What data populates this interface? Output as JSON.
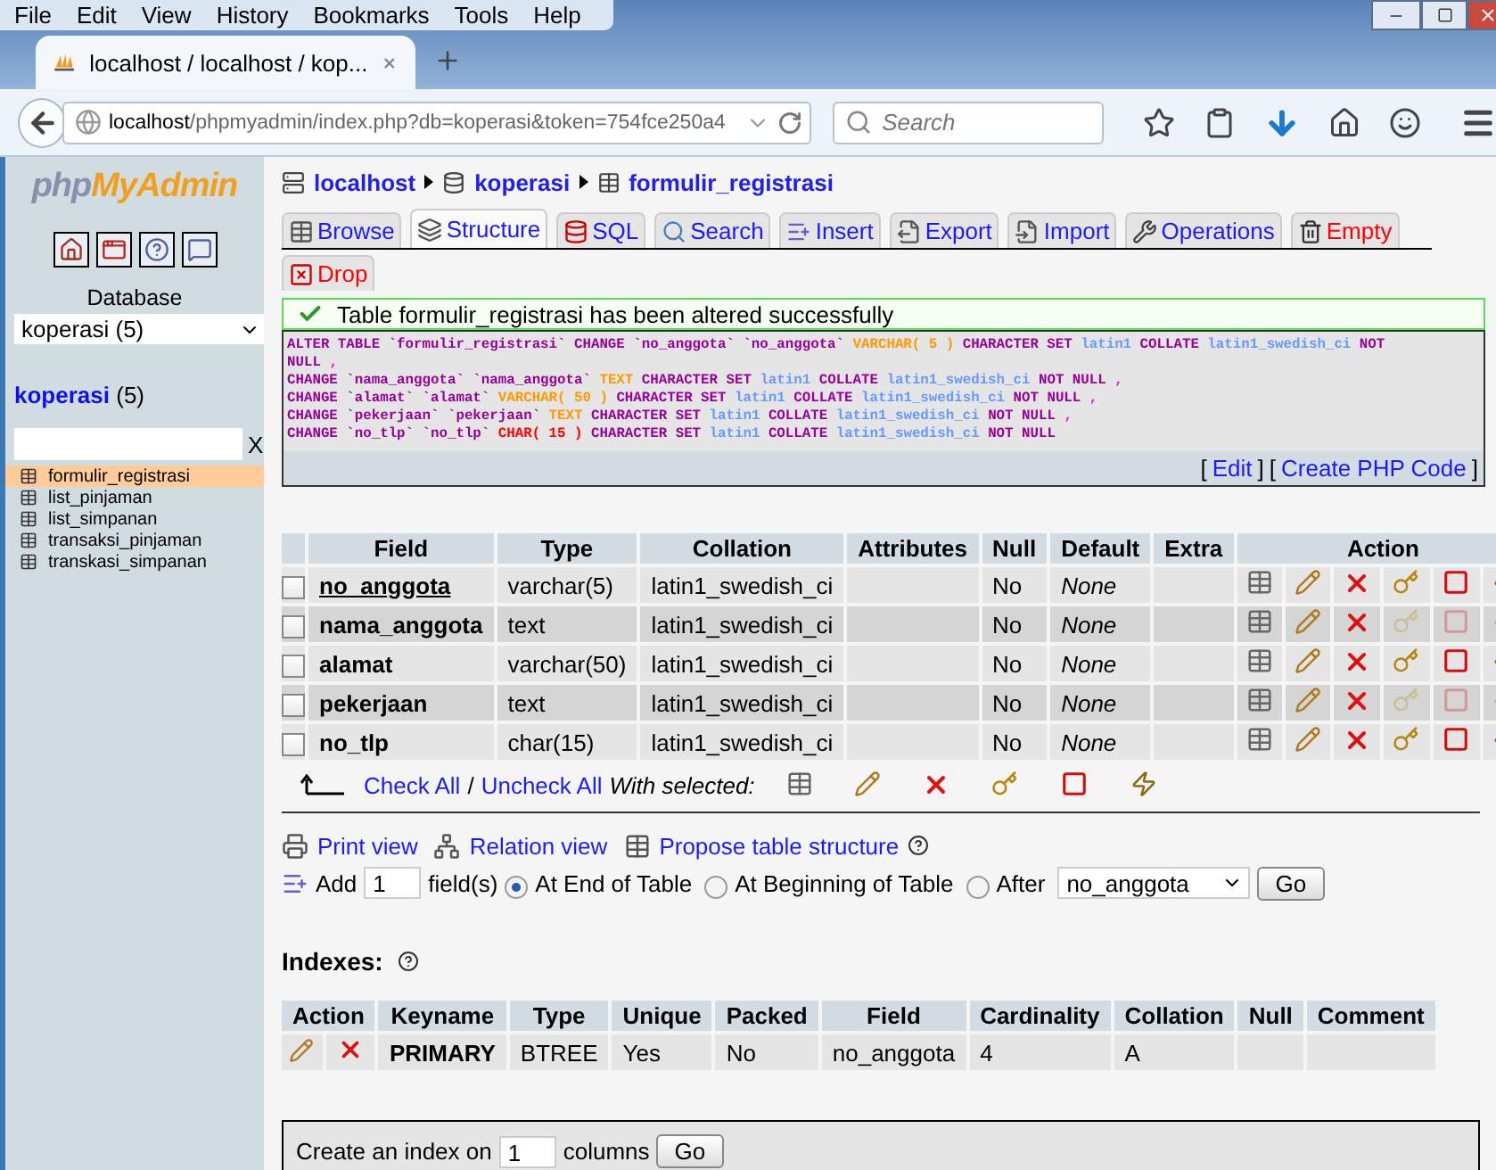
{
  "browser": {
    "menu": [
      "File",
      "Edit",
      "View",
      "History",
      "Bookmarks",
      "Tools",
      "Help"
    ],
    "tab": {
      "title": "localhost / localhost / kop..."
    },
    "url": {
      "host": "localhost",
      "path": "/phpmyadmin/index.php?db=koperasi&token=754fce250a4"
    },
    "search": {
      "placeholder": "Search"
    }
  },
  "sidebar": {
    "logo": {
      "prefix": "php",
      "name": "MyAdmin"
    },
    "database_label": "Database",
    "database_select": "koperasi (5)",
    "db_link": {
      "name": "koperasi",
      "count": "(5)"
    },
    "filter_clear": "X",
    "tables": [
      {
        "name": "formulir_registrasi",
        "selected": true
      },
      {
        "name": "list_pinjaman",
        "selected": false
      },
      {
        "name": "list_simpanan",
        "selected": false
      },
      {
        "name": "transaksi_pinjaman",
        "selected": false
      },
      {
        "name": "transkasi_simpanan",
        "selected": false
      }
    ]
  },
  "breadcrumb": [
    {
      "kind": "server",
      "label": "localhost"
    },
    {
      "kind": "database",
      "label": "koperasi"
    },
    {
      "kind": "table",
      "label": "formulir_registrasi"
    }
  ],
  "tabs": [
    {
      "kind": "browse",
      "label": "Browse",
      "selected": false,
      "danger": false
    },
    {
      "kind": "structure",
      "label": "Structure",
      "selected": true,
      "danger": false
    },
    {
      "kind": "sql",
      "label": "SQL",
      "selected": false,
      "danger": false
    },
    {
      "kind": "search",
      "label": "Search",
      "selected": false,
      "danger": false
    },
    {
      "kind": "insert",
      "label": "Insert",
      "selected": false,
      "danger": false
    },
    {
      "kind": "export",
      "label": "Export",
      "selected": false,
      "danger": false
    },
    {
      "kind": "import",
      "label": "Import",
      "selected": false,
      "danger": false
    },
    {
      "kind": "operations",
      "label": "Operations",
      "selected": false,
      "danger": false
    },
    {
      "kind": "empty",
      "label": "Empty",
      "selected": false,
      "danger": true
    },
    {
      "kind": "drop",
      "label": "Drop",
      "selected": false,
      "danger": true
    }
  ],
  "message": "Table formulir_registrasi has been altered successfully",
  "sql_lines": [
    [
      {
        "text": "ALTER TABLE `formulir_registrasi` CHANGE `no_anggota` `no_anggota`",
        "color": "#990099"
      },
      {
        "text": "VARCHAR( 5 )",
        "color": "#ff9900"
      },
      {
        "text": "CHARACTER SET",
        "color": "#990099"
      },
      {
        "text": "latin1",
        "color": "#6699ff"
      },
      {
        "text": "COLLATE",
        "color": "#990099"
      },
      {
        "text": "latin1_swedish_ci",
        "color": "#6699ff"
      },
      {
        "text": "NOT",
        "color": "#990099"
      }
    ],
    [
      {
        "text": "NULL",
        "color": "#990099"
      },
      {
        "text": ",",
        "color": "#ff00ff"
      }
    ],
    [
      {
        "text": "CHANGE `nama_anggota` `nama_anggota`",
        "color": "#990099"
      },
      {
        "text": "TEXT",
        "color": "#ff9900"
      },
      {
        "text": "CHARACTER SET",
        "color": "#990099"
      },
      {
        "text": "latin1",
        "color": "#6699ff"
      },
      {
        "text": "COLLATE",
        "color": "#990099"
      },
      {
        "text": "latin1_swedish_ci",
        "color": "#6699ff"
      },
      {
        "text": "NOT NULL",
        "color": "#990099"
      },
      {
        "text": ",",
        "color": "#ff00ff"
      }
    ],
    [
      {
        "text": "CHANGE `alamat` `alamat`",
        "color": "#990099"
      },
      {
        "text": "VARCHAR( 50 )",
        "color": "#ff9900"
      },
      {
        "text": "CHARACTER SET",
        "color": "#990099"
      },
      {
        "text": "latin1",
        "color": "#6699ff"
      },
      {
        "text": "COLLATE",
        "color": "#990099"
      },
      {
        "text": "latin1_swedish_ci",
        "color": "#6699ff"
      },
      {
        "text": "NOT NULL",
        "color": "#990099"
      },
      {
        "text": ",",
        "color": "#ff00ff"
      }
    ],
    [
      {
        "text": "CHANGE `pekerjaan` `pekerjaan`",
        "color": "#990099"
      },
      {
        "text": "TEXT",
        "color": "#ff9900"
      },
      {
        "text": "CHARACTER SET",
        "color": "#990099"
      },
      {
        "text": "latin1",
        "color": "#6699ff"
      },
      {
        "text": "COLLATE",
        "color": "#990099"
      },
      {
        "text": "latin1_swedish_ci",
        "color": "#6699ff"
      },
      {
        "text": "NOT NULL",
        "color": "#990099"
      },
      {
        "text": ",",
        "color": "#ff00ff"
      }
    ],
    [
      {
        "text": "CHANGE `no_tlp` `no_tlp`",
        "color": "#990099"
      },
      {
        "text": "CHAR( 15 )",
        "color": "#ff0000"
      },
      {
        "text": "CHARACTER SET",
        "color": "#990099"
      },
      {
        "text": "latin1",
        "color": "#6699ff"
      },
      {
        "text": "COLLATE",
        "color": "#990099"
      },
      {
        "text": "latin1_swedish_ci",
        "color": "#6699ff"
      },
      {
        "text": "NOT NULL",
        "color": "#990099"
      }
    ]
  ],
  "query_links": [
    {
      "before": "[",
      "label": "Edit",
      "after": "]"
    },
    {
      "before": "[",
      "label": "Create PHP Code",
      "after": "]"
    }
  ],
  "structure": {
    "columns": [
      "Field",
      "Type",
      "Collation",
      "Attributes",
      "Null",
      "Default",
      "Extra",
      "Action"
    ],
    "rows": [
      {
        "field": "no_anggota",
        "primary": true,
        "type": "varchar(5)",
        "collation": "latin1_swedish_ci",
        "null": "No",
        "default": "None",
        "checked": false,
        "keys_disabled": false
      },
      {
        "field": "nama_anggota",
        "primary": false,
        "type": "text",
        "collation": "latin1_swedish_ci",
        "null": "No",
        "default": "None",
        "checked": false,
        "keys_disabled": true
      },
      {
        "field": "alamat",
        "primary": false,
        "type": "varchar(50)",
        "collation": "latin1_swedish_ci",
        "null": "No",
        "default": "None",
        "checked": false,
        "keys_disabled": false
      },
      {
        "field": "pekerjaan",
        "primary": false,
        "type": "text",
        "collation": "latin1_swedish_ci",
        "null": "No",
        "default": "None",
        "checked": false,
        "keys_disabled": true
      },
      {
        "field": "no_tlp",
        "primary": false,
        "type": "char(15)",
        "collation": "latin1_swedish_ci",
        "null": "No",
        "default": "None",
        "checked": false,
        "keys_disabled": false
      }
    ]
  },
  "bulk": {
    "check_all": "Check All",
    "separator": "/",
    "uncheck_all": "Uncheck All",
    "with_selected": "With selected:"
  },
  "links": [
    {
      "kind": "print",
      "label": "Print view"
    },
    {
      "kind": "relation",
      "label": "Relation view"
    },
    {
      "kind": "propose",
      "label": "Propose table structure"
    }
  ],
  "add_field": {
    "label": "Add",
    "value": "1",
    "unit": "field(s)",
    "positions": [
      {
        "label": "At End of Table",
        "selected": true
      },
      {
        "label": "At Beginning of Table",
        "selected": false
      },
      {
        "label": "After",
        "selected": false
      }
    ],
    "after_column": "no_anggota",
    "button": "Go"
  },
  "indexes": {
    "title": "Indexes:",
    "columns": [
      "Action",
      "Keyname",
      "Type",
      "Unique",
      "Packed",
      "Field",
      "Cardinality",
      "Collation",
      "Null",
      "Comment"
    ],
    "rows": [
      {
        "keyname": "PRIMARY",
        "type": "BTREE",
        "unique": "Yes",
        "packed": "No",
        "field": "no_anggota",
        "cardinality": "4",
        "collation": "A"
      }
    ]
  },
  "create_index": {
    "before": "Create an index on",
    "value": "1",
    "after": "columns",
    "button": "Go"
  }
}
